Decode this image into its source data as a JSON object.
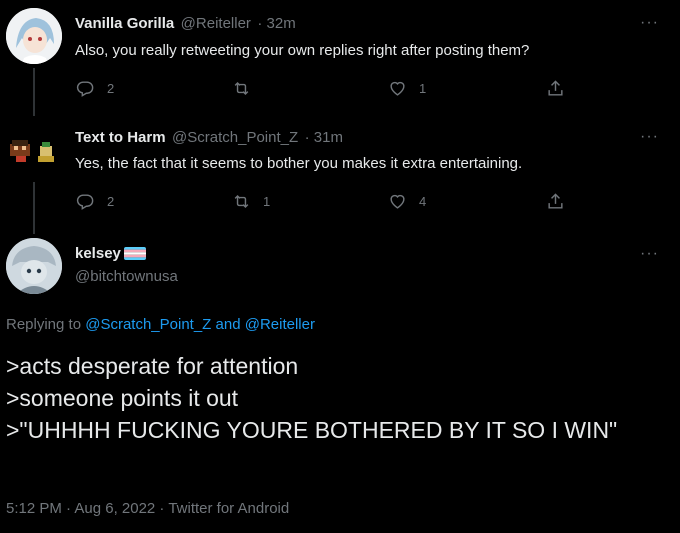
{
  "tweets": [
    {
      "name": "Vanilla Gorilla",
      "handle": "@Reiteller",
      "time": "· 32m",
      "text": "Also, you really retweeting your own replies right after posting them?",
      "replies": "2",
      "retweets": "",
      "likes": "1",
      "more": "···"
    },
    {
      "name": "Text to Harm",
      "handle": "@Scratch_Point_Z",
      "time": "· 31m",
      "text": "Yes, the fact that it seems to bother you makes it extra entertaining.",
      "replies": "2",
      "retweets": "1",
      "likes": "4",
      "more": "···"
    }
  ],
  "main": {
    "name": "kelsey",
    "handle": "@bitchtownusa",
    "more": "···",
    "replying_prefix": "Replying to ",
    "replying_user1": "@Scratch_Point_Z",
    "replying_and": " and ",
    "replying_user2": "@Reiteller",
    "lines": [
      ">acts desperate for attention",
      ">someone points it out",
      ">\"UHHHH FUCKING YOURE BOTHERED BY IT SO I WIN\""
    ],
    "meta": "5:12 PM · Aug 6, 2022 · Twitter for Android"
  },
  "colors": {
    "background": "#000000",
    "text": "#e7e9ea",
    "muted": "#71767b",
    "link": "#1d9bf0"
  },
  "icons": [
    "reply-icon",
    "retweet-icon",
    "like-icon",
    "share-icon",
    "more-icon",
    "trans-flag-icon"
  ]
}
